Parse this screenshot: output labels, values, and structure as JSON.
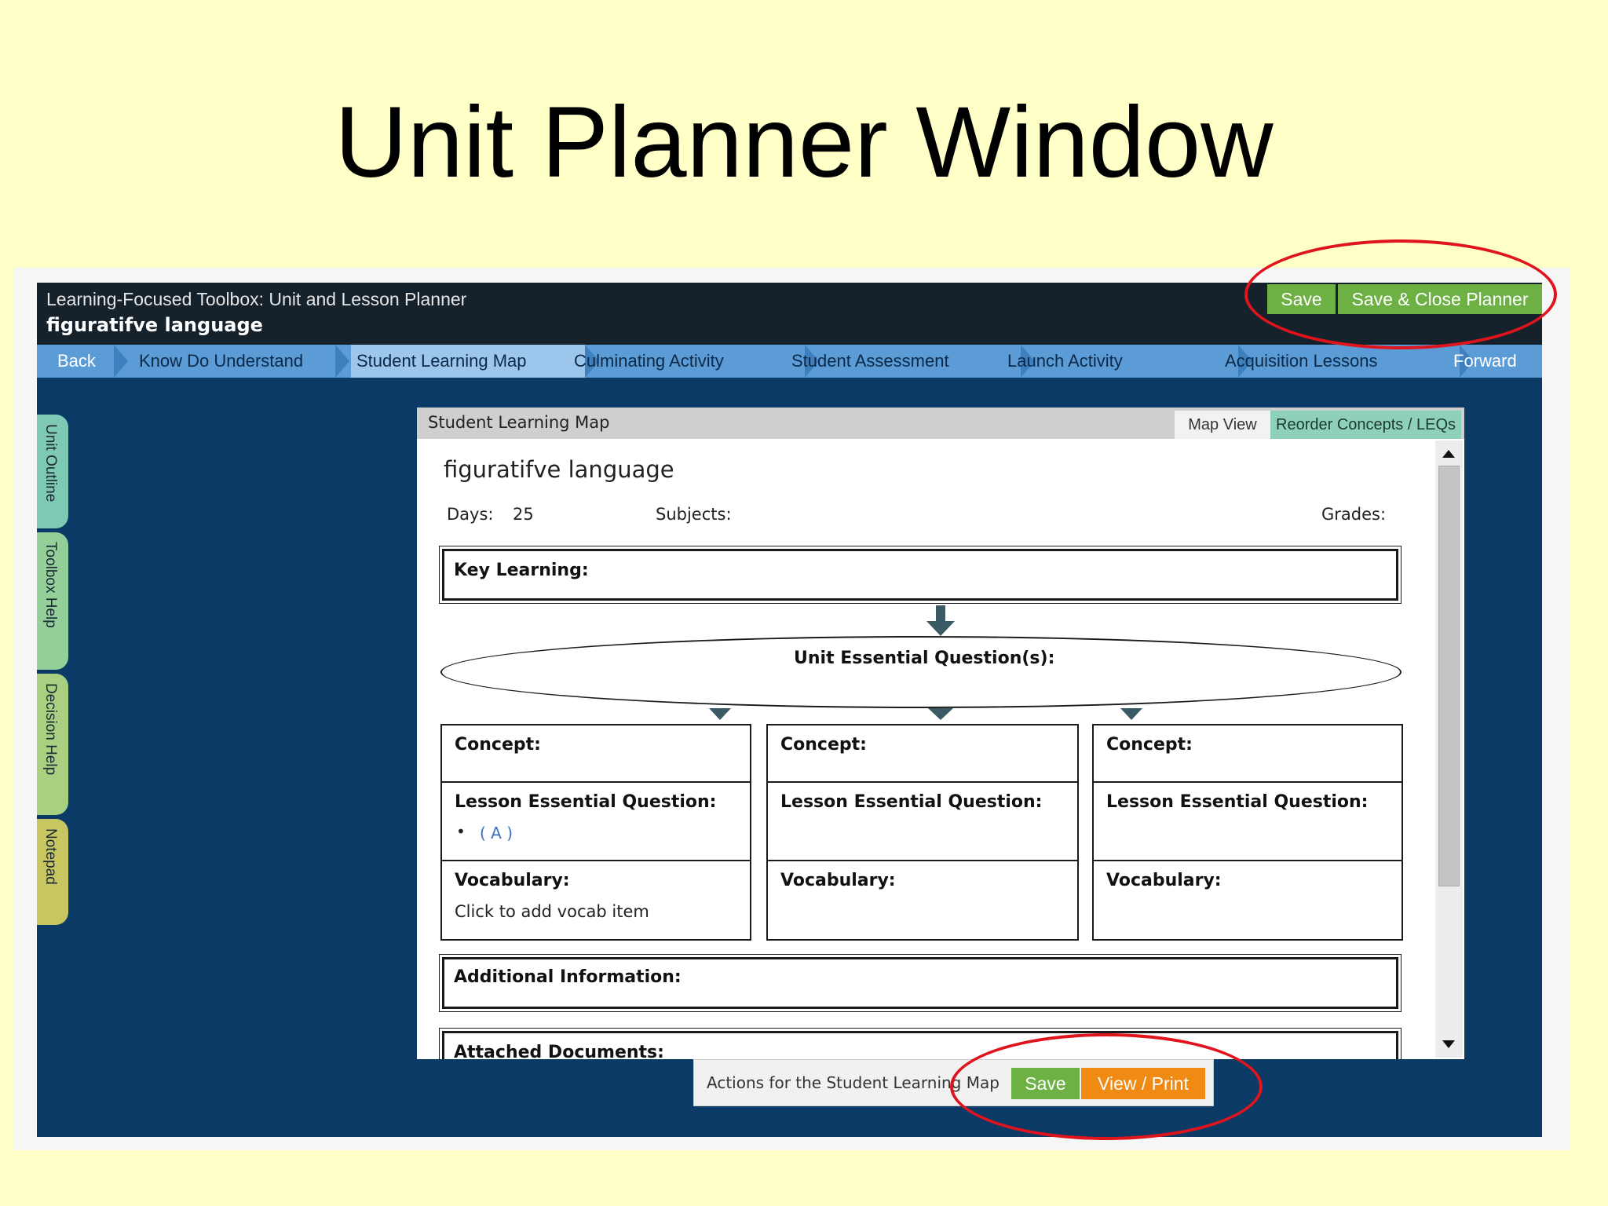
{
  "slide": {
    "title": "Unit Planner Window"
  },
  "header": {
    "app_title": "Learning-Focused Toolbox: Unit and Lesson Planner",
    "unit_name": "figuratifve language",
    "save_label": "Save",
    "save_close_label": "Save & Close Planner"
  },
  "nav": {
    "back": "Back",
    "items": [
      "Know Do Understand",
      "Student Learning Map",
      "Culminating Activity",
      "Student Assessment",
      "Launch Activity",
      "Acquisition Lessons"
    ],
    "forward": "Forward",
    "active_index": 1
  },
  "side_tabs": [
    "Unit Outline",
    "Toolbox Help",
    "Decision Help",
    "Notepad"
  ],
  "panel": {
    "title": "Student Learning Map",
    "tab_map_view": "Map View",
    "tab_reorder": "Reorder Concepts / LEQs"
  },
  "map": {
    "title": "figuratifve language",
    "days_label": "Days:",
    "days_value": "25",
    "subjects_label": "Subjects:",
    "grades_label": "Grades:",
    "key_learning_label": "Key Learning:",
    "ueq_label": "Unit Essential Question(s):",
    "concept_label": "Concept:",
    "leq_label": "Lesson Essential Question:",
    "vocab_label": "Vocabulary:",
    "leq_item": "( A )",
    "vocab_add": "Click to add vocab item",
    "additional_label": "Additional Information:",
    "attached_label": "Attached Documents:"
  },
  "actions": {
    "text": "Actions for the Student Learning Map",
    "save": "Save",
    "view_print": "View / Print"
  },
  "colors": {
    "slide_bg": "#ffffc8",
    "app_bg": "#0c3a66",
    "header_bg": "#15222c",
    "nav_bg": "#5b9bd6",
    "green_button": "#6db044",
    "orange_button": "#f08a12",
    "annotation_red": "#e0141c"
  }
}
